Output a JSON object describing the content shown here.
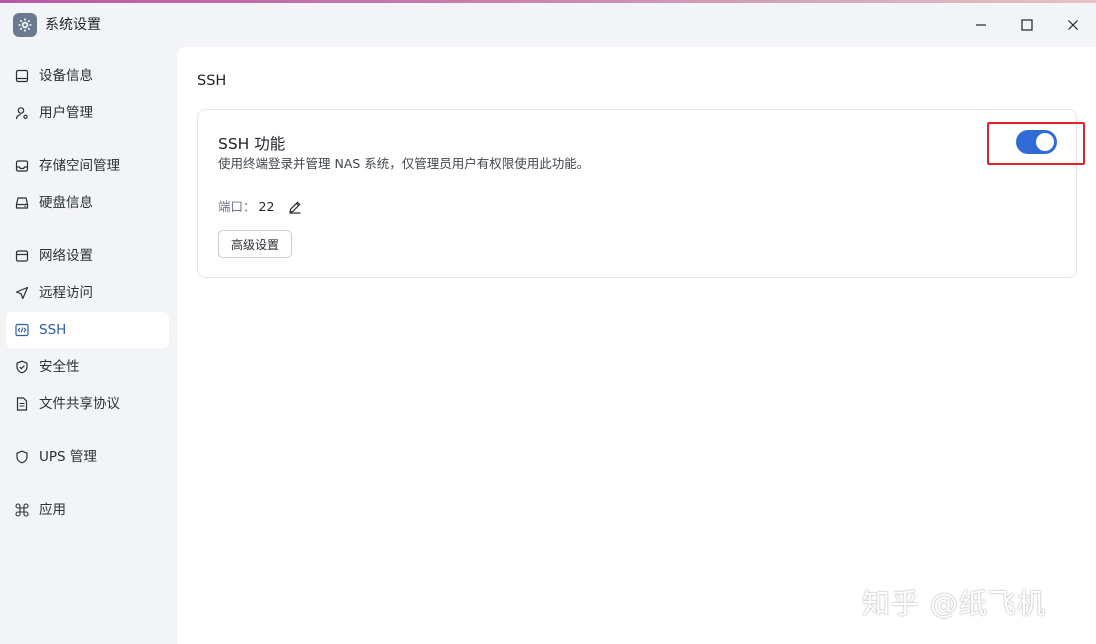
{
  "window": {
    "title": "系统设置",
    "icon": "gear-icon"
  },
  "colors": {
    "accent": "#2f6ad6",
    "active_text": "#2f5da8",
    "highlight_box": "#e0262a"
  },
  "sidebar": {
    "items": [
      {
        "label": "设备信息",
        "icon": "monitor-icon"
      },
      {
        "label": "用户管理",
        "icon": "user-gear-icon"
      },
      {
        "label": "存储空间管理",
        "icon": "storage-icon"
      },
      {
        "label": "硬盘信息",
        "icon": "hard-disk-icon"
      },
      {
        "label": "网络设置",
        "icon": "network-icon"
      },
      {
        "label": "远程访问",
        "icon": "send-arrow-icon"
      },
      {
        "label": "SSH",
        "icon": "code-icon",
        "active": true
      },
      {
        "label": "安全性",
        "icon": "shield-check-icon"
      },
      {
        "label": "文件共享协议",
        "icon": "document-icon"
      },
      {
        "label": "UPS 管理",
        "icon": "shield-outline-icon"
      },
      {
        "label": "应用",
        "icon": "command-icon"
      }
    ]
  },
  "main": {
    "title": "SSH",
    "card": {
      "title": "SSH 功能",
      "description": "使用终端登录并管理 NAS 系统，仅管理员用户有权限使用此功能。",
      "toggle_on": true,
      "port_label": "端口：",
      "port_value": "22",
      "advanced_button": "高级设置"
    }
  },
  "watermark": "知乎 @纸飞机"
}
